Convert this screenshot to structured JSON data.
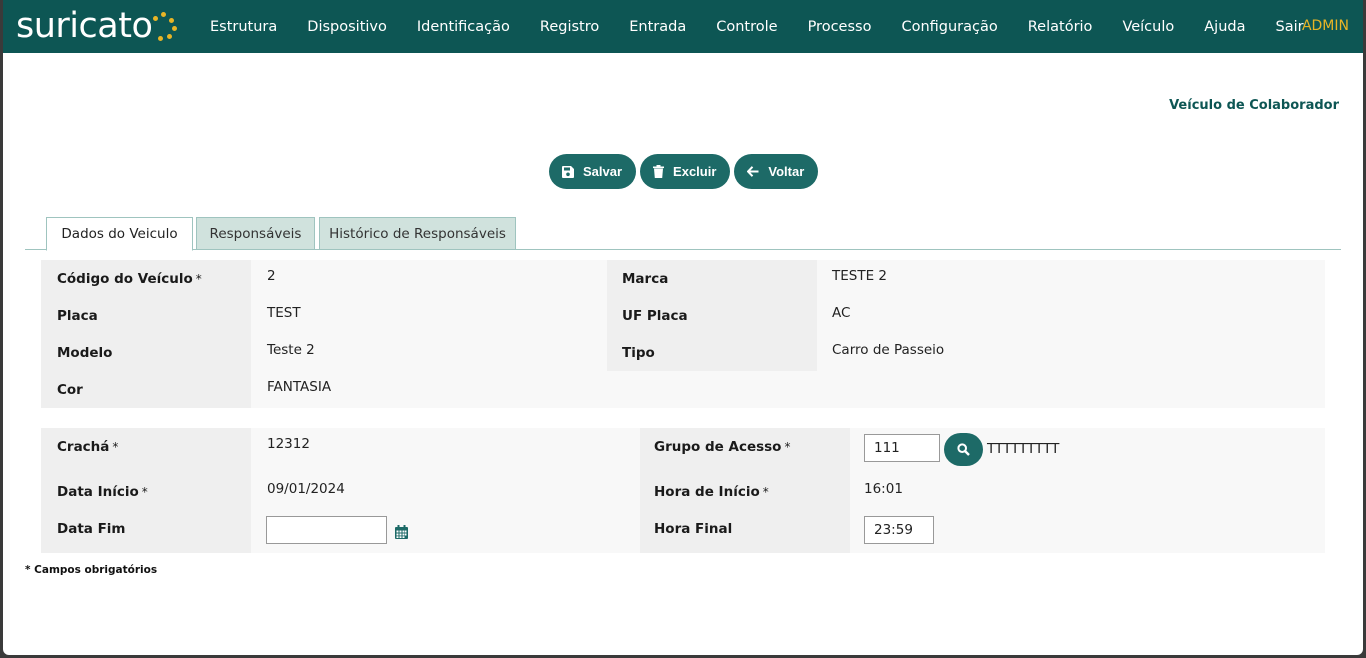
{
  "navbar": {
    "logo_text": "suricato",
    "menu": [
      "Estrutura",
      "Dispositivo",
      "Identificação",
      "Registro",
      "Entrada",
      "Controle",
      "Processo",
      "Configuração",
      "Relatório",
      "Veículo",
      "Ajuda",
      "Sair"
    ],
    "user": "ADMIN",
    "brand_color": "#0d5654",
    "accent_color": "#e8b526"
  },
  "page": {
    "title": "Veículo de Colaborador"
  },
  "actions": {
    "save": "Salvar",
    "delete": "Excluir",
    "back": "Voltar"
  },
  "tabs": [
    "Dados do Veiculo",
    "Responsáveis",
    "Histórico de Responsáveis"
  ],
  "vehicle": {
    "code_label": "Código do Veículo",
    "code_value": "2",
    "plate_label": "Placa",
    "plate_value": "TEST",
    "model_label": "Modelo",
    "model_value": "Teste 2",
    "color_label": "Cor",
    "color_value": "FANTASIA",
    "brand_label": "Marca",
    "brand_value": "TESTE 2",
    "uf_label": "UF Placa",
    "uf_value": "AC",
    "type_label": "Tipo",
    "type_value": "Carro de Passeio",
    "required_mark": "*"
  },
  "access": {
    "badge_label": "Crachá",
    "badge_value": "12312",
    "start_date_label": "Data Início",
    "start_date_value": "09/01/2024",
    "end_date_label": "Data Fim",
    "end_date_value": "",
    "group_label": "Grupo de Acesso",
    "group_value": "111",
    "group_name": "TTTTTTTTT",
    "start_time_label": "Hora de Início",
    "start_time_value": "16:01",
    "end_time_label": "Hora Final",
    "end_time_value": "23:59"
  },
  "footer": {
    "required_note": "* Campos obrigatórios"
  }
}
